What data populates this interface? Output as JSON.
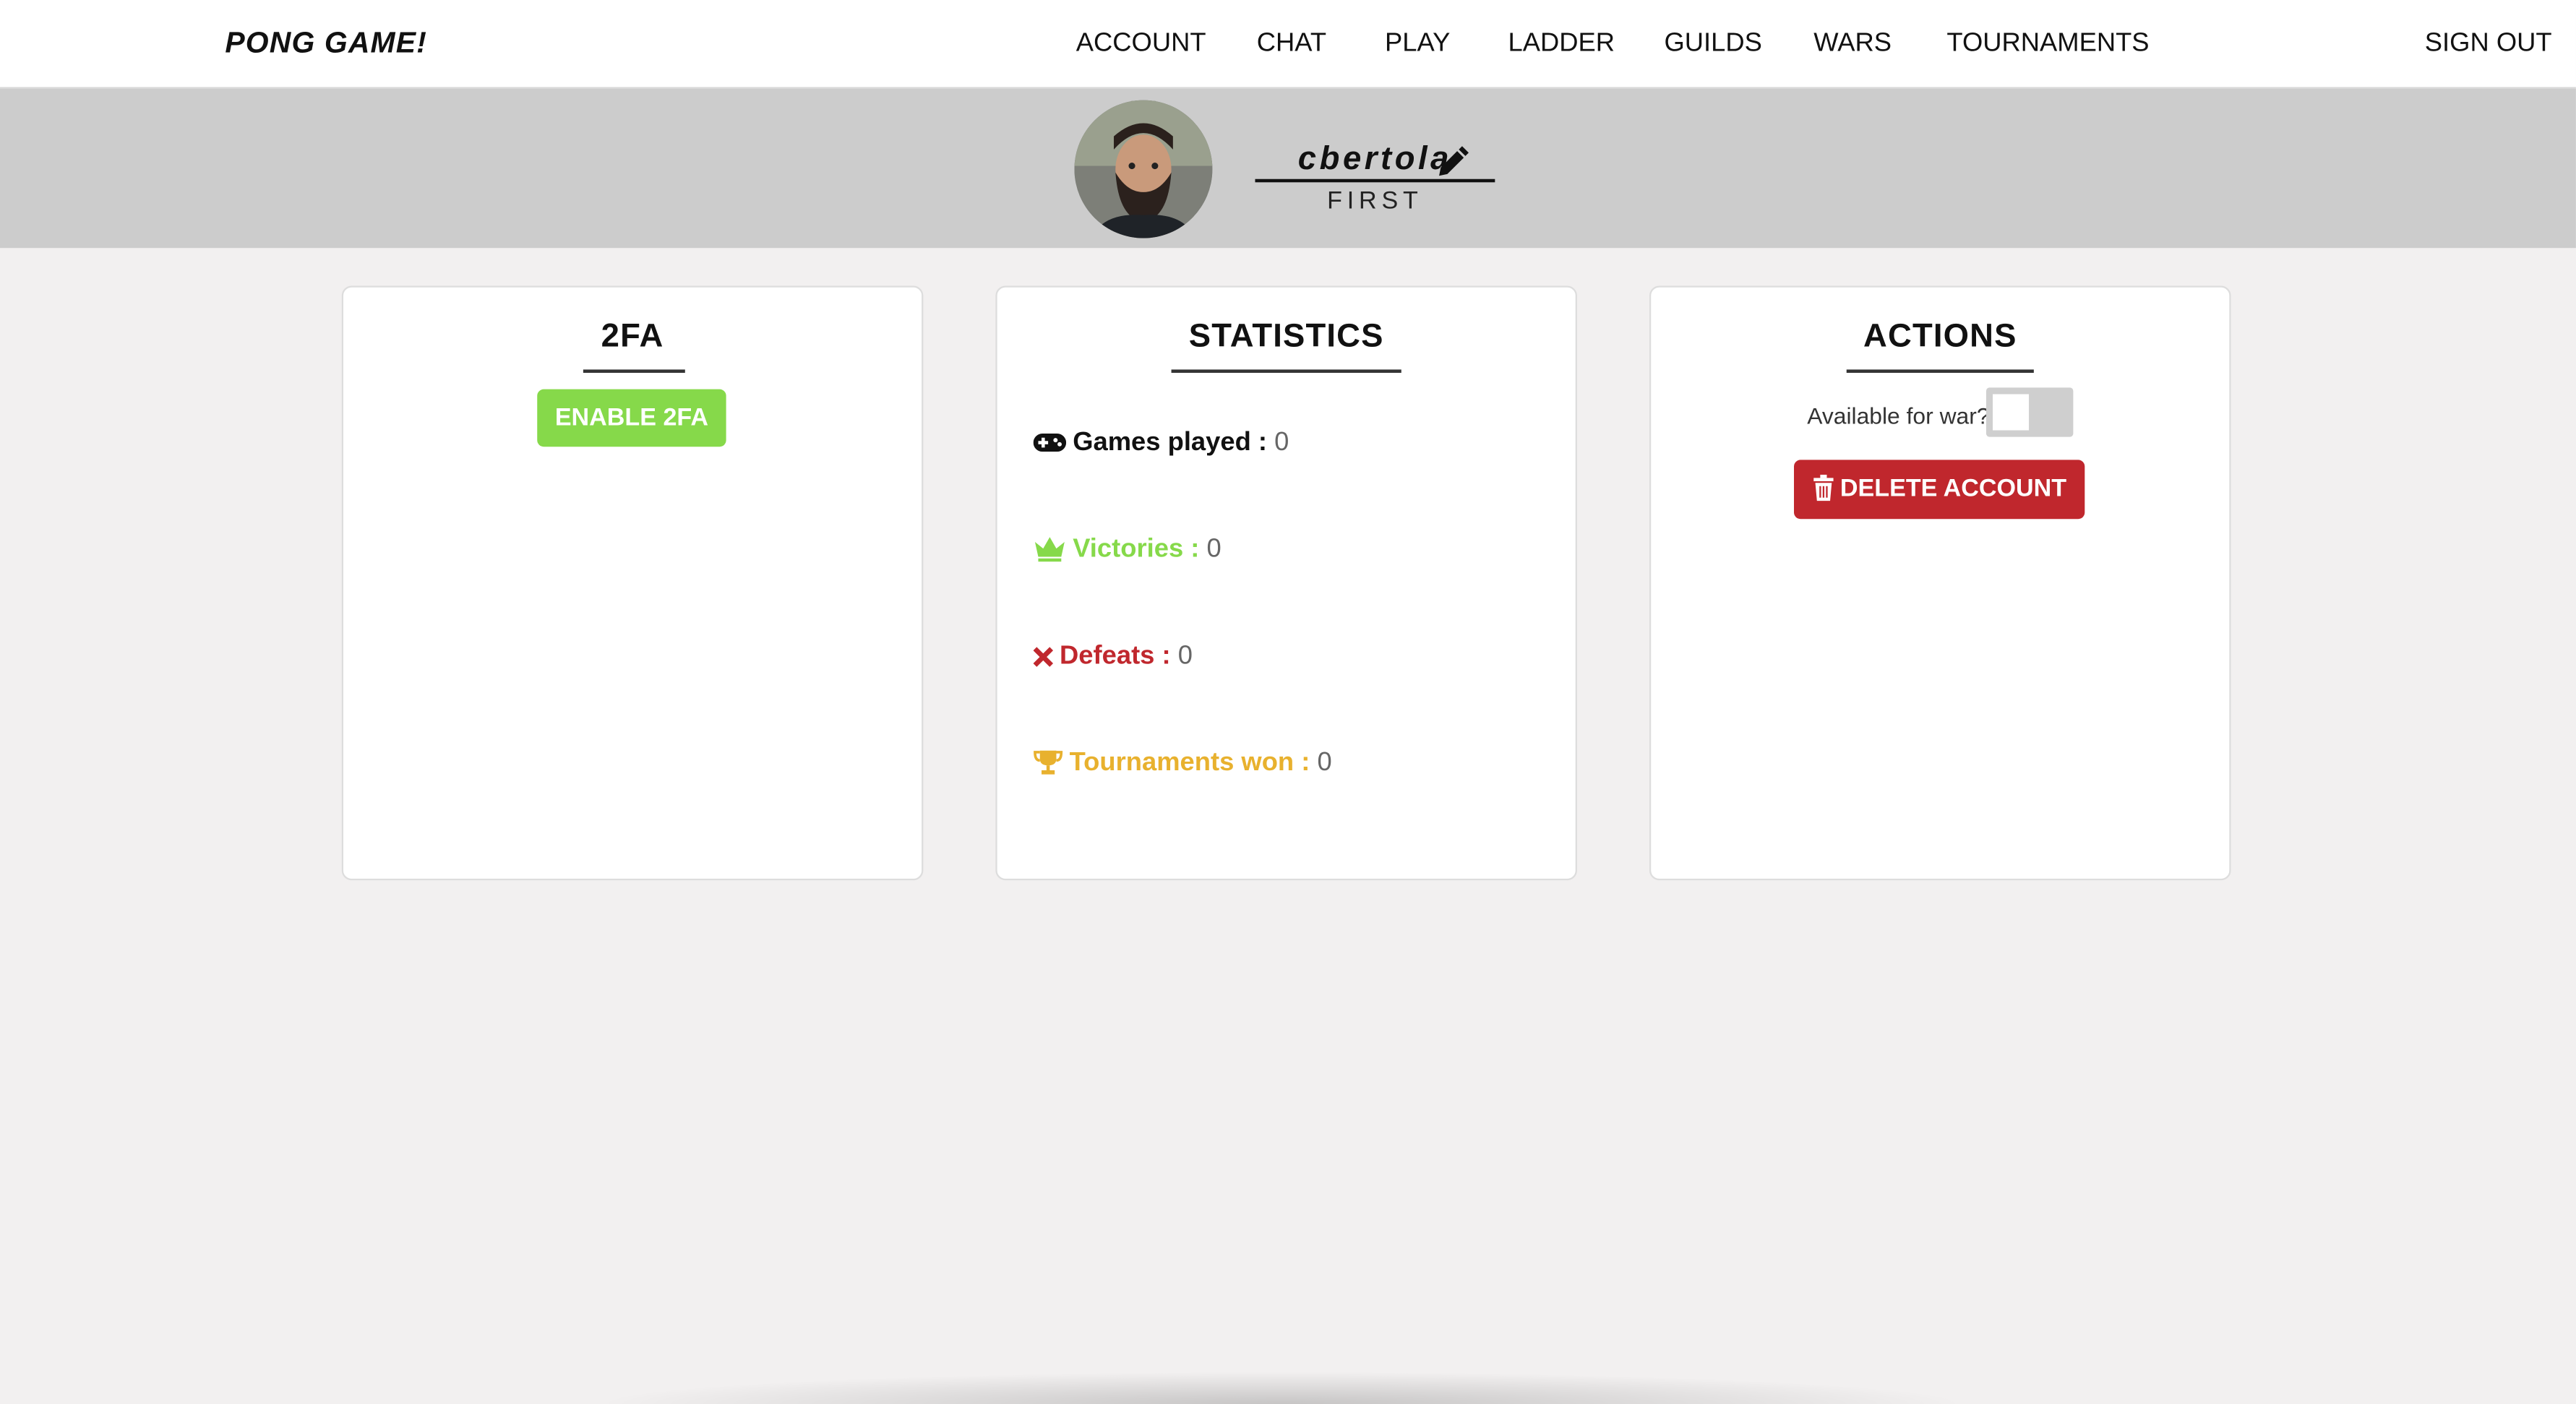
{
  "navbar": {
    "brand": "PONG GAME!",
    "items": [
      {
        "label": "ACCOUNT"
      },
      {
        "label": "CHAT"
      },
      {
        "label": "PLAY"
      },
      {
        "label": "LADDER"
      },
      {
        "label": "GUILDS"
      },
      {
        "label": "WARS"
      },
      {
        "label": "TOURNAMENTS"
      }
    ],
    "sign_out": "SIGN OUT"
  },
  "profile": {
    "username": "cbertola",
    "rank": "FIRST",
    "avatar_icon": "user-avatar",
    "edit_icon": "pencil-icon"
  },
  "cards": {
    "twofa": {
      "title": "2FA",
      "button_label": "ENABLE 2FA"
    },
    "statistics": {
      "title": "STATISTICS",
      "games_played": {
        "label": "Games played :",
        "value": "0",
        "icon": "gamepad-icon",
        "color": "#111111"
      },
      "victories": {
        "label": "Victories :",
        "value": "0",
        "icon": "crown-icon",
        "color": "#86d94a"
      },
      "defeats": {
        "label": "Defeats :",
        "value": "0",
        "icon": "cross-icon",
        "color": "#c0272d"
      },
      "tournaments_won": {
        "label": "Tournaments won :",
        "value": "0",
        "icon": "trophy-icon",
        "color": "#e8b12e"
      }
    },
    "actions": {
      "title": "ACTIONS",
      "war_label": "Available for war?",
      "war_available": false,
      "delete_label": "DELETE ACCOUNT",
      "delete_icon": "trash-icon"
    }
  },
  "colors": {
    "green": "#86d94a",
    "red": "#c0272d",
    "gold": "#e8b12e",
    "banner": "#cccccc",
    "background": "#f2f0f0"
  }
}
